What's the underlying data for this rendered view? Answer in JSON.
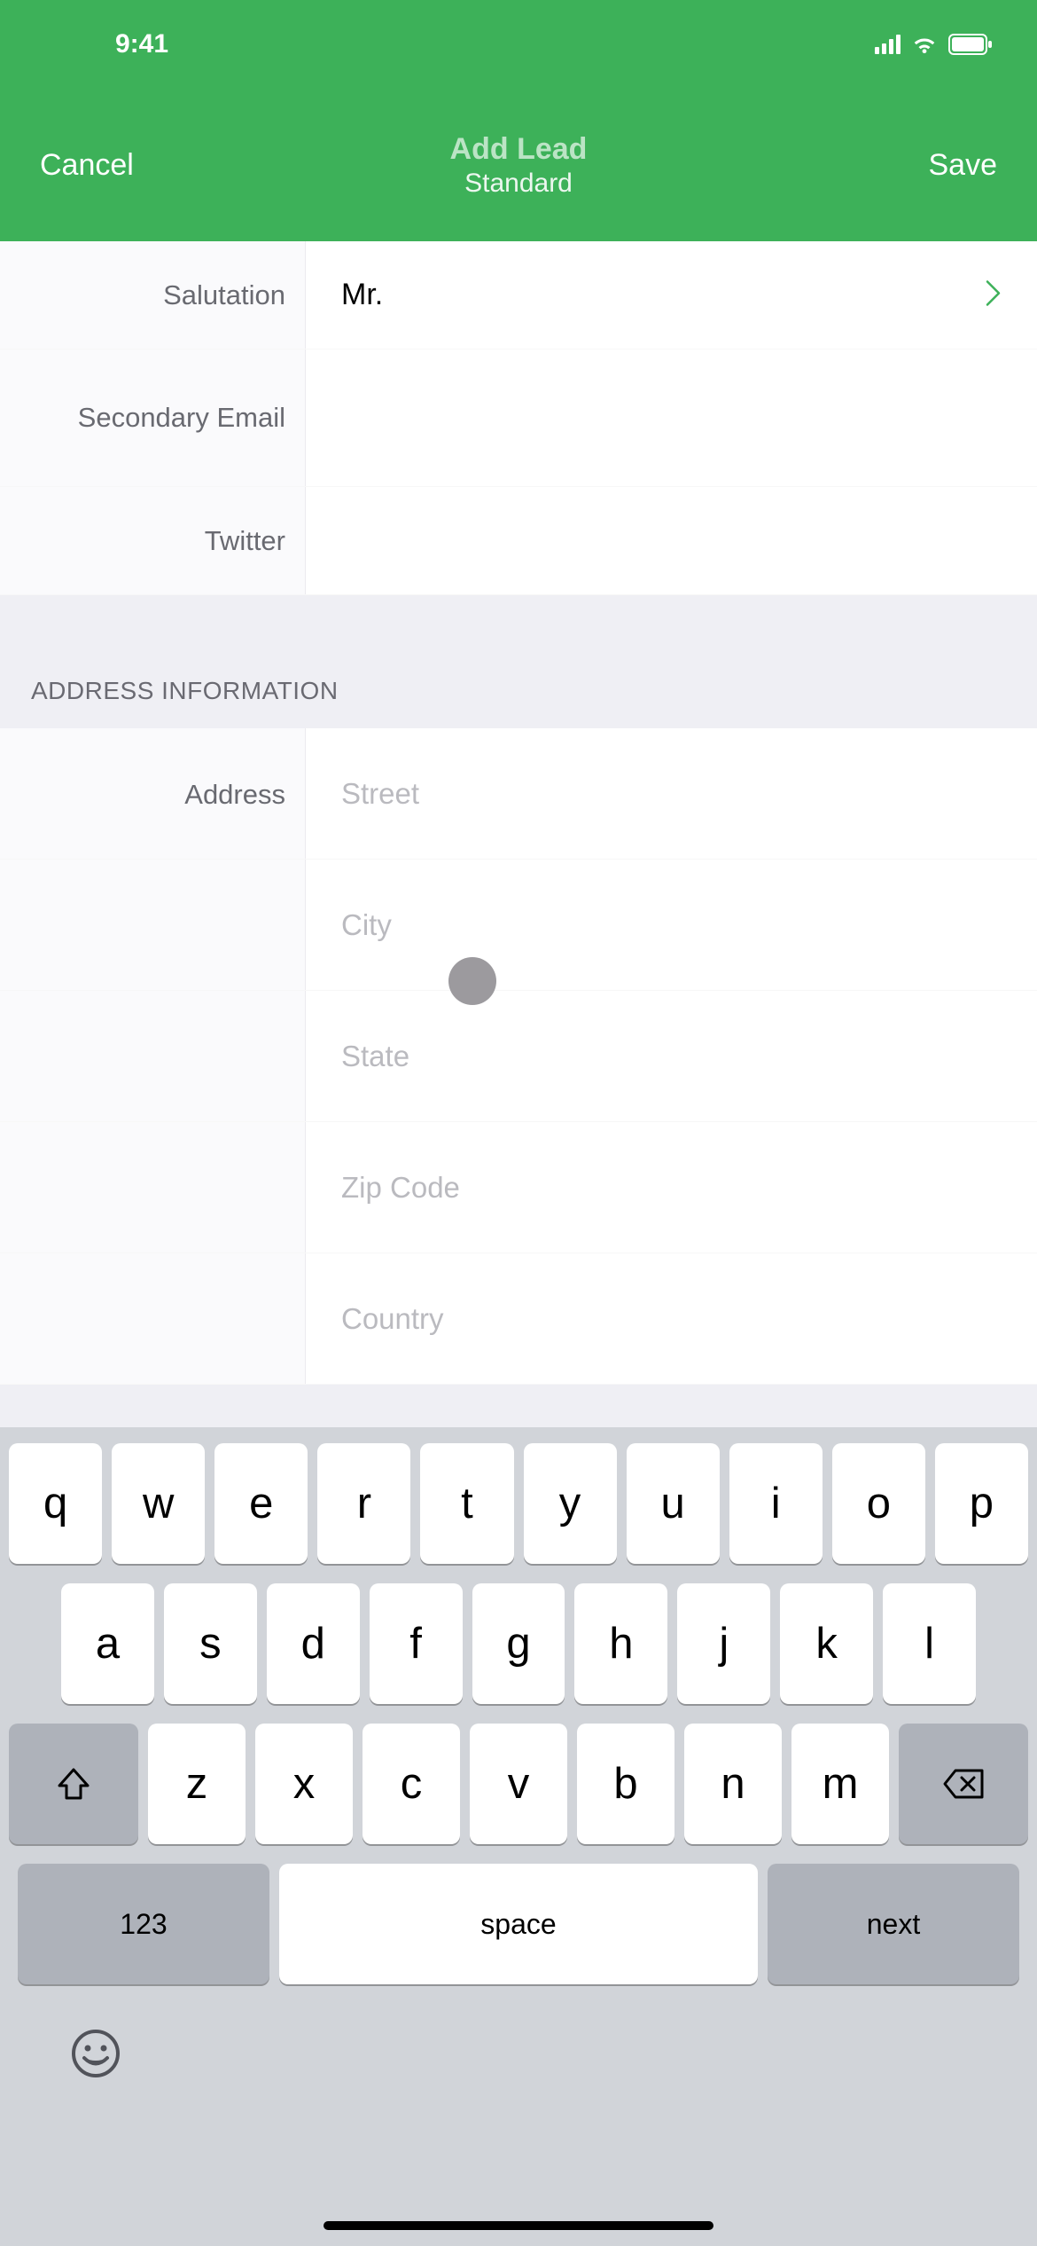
{
  "status": {
    "time": "9:41"
  },
  "nav": {
    "cancel": "Cancel",
    "title": "Add Lead",
    "subtitle": "Standard",
    "save": "Save"
  },
  "form": {
    "salutation_label": "Salutation",
    "salutation_value": "Mr.",
    "secondary_email_label": "Secondary Email",
    "secondary_email_value": "",
    "twitter_label": "Twitter",
    "twitter_value": ""
  },
  "section_header": "ADDRESS INFORMATION",
  "address": {
    "label": "Address",
    "street_placeholder": "Street",
    "street_value": "",
    "city_placeholder": "City",
    "city_value": "",
    "state_placeholder": "State",
    "state_value": "",
    "zip_placeholder": "Zip Code",
    "zip_value": "",
    "country_placeholder": "Country",
    "country_value": ""
  },
  "keyboard": {
    "row1": [
      "q",
      "w",
      "e",
      "r",
      "t",
      "y",
      "u",
      "i",
      "o",
      "p"
    ],
    "row2": [
      "a",
      "s",
      "d",
      "f",
      "g",
      "h",
      "j",
      "k",
      "l"
    ],
    "row3": [
      "z",
      "x",
      "c",
      "v",
      "b",
      "n",
      "m"
    ],
    "numbers": "123",
    "space": "space",
    "next": "next"
  }
}
